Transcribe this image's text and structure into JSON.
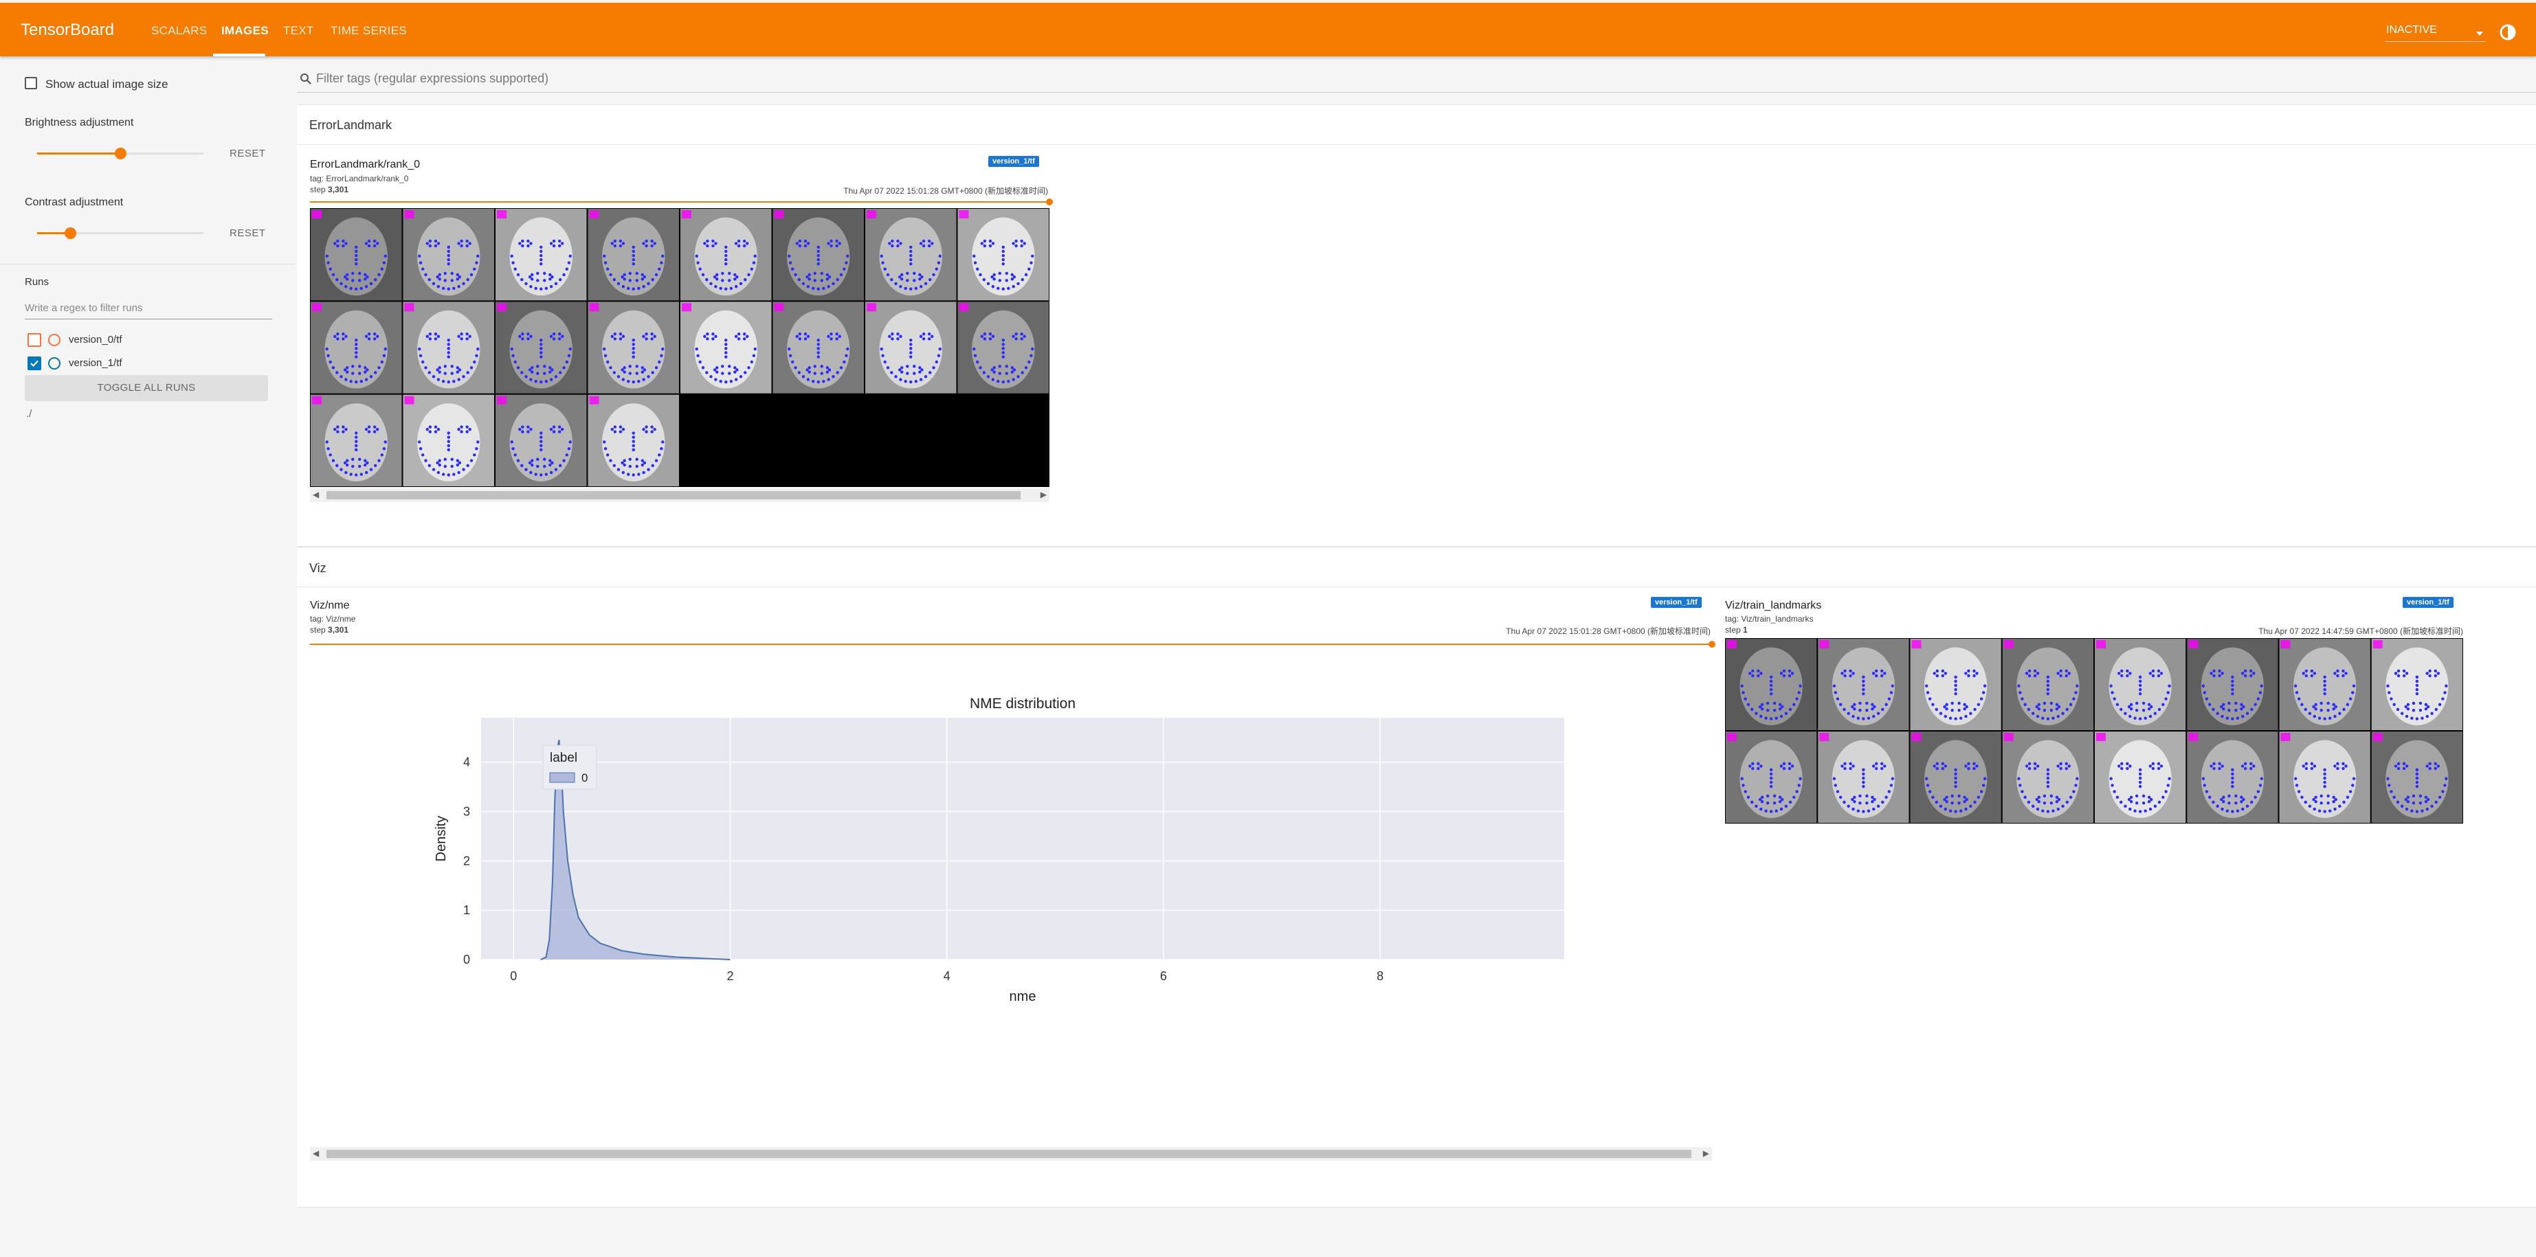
{
  "header": {
    "brand": "TensorBoard",
    "tabs": [
      {
        "label": "SCALARS",
        "active": false
      },
      {
        "label": "IMAGES",
        "active": true
      },
      {
        "label": "TEXT",
        "active": false
      },
      {
        "label": "TIME SERIES",
        "active": false
      }
    ],
    "status": "INACTIVE",
    "accent_color": "#f57c00"
  },
  "sidebar": {
    "show_actual_size_label": "Show actual image size",
    "show_actual_size_checked": false,
    "brightness_label": "Brightness adjustment",
    "brightness_level": 0.5,
    "contrast_label": "Contrast adjustment",
    "contrast_level": 0.2,
    "reset_label": "RESET",
    "runs_label": "Runs",
    "runs_filter_placeholder": "Write a regex to filter runs",
    "runs": [
      {
        "name": "version_0/tf",
        "checked": false,
        "color": "#ff7043"
      },
      {
        "name": "version_1/tf",
        "checked": true,
        "color": "#0077bb"
      }
    ],
    "toggle_all_label": "TOGGLE ALL RUNS",
    "footer_path": "./"
  },
  "main": {
    "filter_placeholder": "Filter tags (regular expressions supported)",
    "sections": [
      {
        "title": "ErrorLandmark",
        "cards": [
          {
            "title": "ErrorLandmark/rank_0",
            "tag": "tag: ErrorLandmark/rank_0",
            "step_label": "step",
            "step": "3,301",
            "timestamp": "Thu Apr 07 2022 15:01:28 GMT+0800 (新加坡标准时间)",
            "run": "version_1/tf",
            "image": {
              "rows": 3,
              "cols": 8,
              "filled_tiles": 20
            }
          }
        ]
      },
      {
        "title": "Viz",
        "cards": [
          {
            "title": "Viz/nme",
            "tag": "tag: Viz/nme",
            "step_label": "step",
            "step": "3,301",
            "timestamp": "Thu Apr 07 2022 15:01:28 GMT+0800 (新加坡标准时间)",
            "run": "version_1/tf"
          },
          {
            "title": "Viz/train_landmarks",
            "tag": "tag: Viz/train_landmarks",
            "step_label": "step",
            "step": "1",
            "timestamp": "Thu Apr 07 2022 14:47:59 GMT+0800 (新加坡标准时间)",
            "run": "version_1/tf",
            "image": {
              "rows": 2,
              "cols": 8,
              "filled_tiles": 16
            }
          }
        ]
      }
    ]
  },
  "chart_data": {
    "type": "area",
    "title": "NME distribution",
    "xlabel": "nme",
    "ylabel": "Density",
    "xlim": [
      -0.3,
      9.7
    ],
    "ylim": [
      0,
      4.9
    ],
    "xticks": [
      0,
      2,
      4,
      6,
      8
    ],
    "yticks": [
      0,
      1,
      2,
      3,
      4
    ],
    "grid": true,
    "legend": {
      "title": "label",
      "entries": [
        "0"
      ],
      "placement": "top-left"
    },
    "series": [
      {
        "name": "0",
        "x": [
          0.25,
          0.3,
          0.33,
          0.36,
          0.38,
          0.4,
          0.42,
          0.44,
          0.46,
          0.5,
          0.55,
          0.6,
          0.7,
          0.8,
          1.0,
          1.2,
          1.5,
          1.8,
          2.0
        ],
        "y": [
          0,
          0.05,
          0.4,
          1.6,
          3.2,
          4.25,
          4.45,
          3.9,
          3.0,
          2.0,
          1.3,
          0.85,
          0.5,
          0.33,
          0.18,
          0.11,
          0.05,
          0.02,
          0
        ]
      }
    ],
    "colors": {
      "fill": "#aeb9dc",
      "line": "#4c72b0",
      "plot_bg": "#e8e8f0",
      "grid": "#ffffff"
    }
  }
}
